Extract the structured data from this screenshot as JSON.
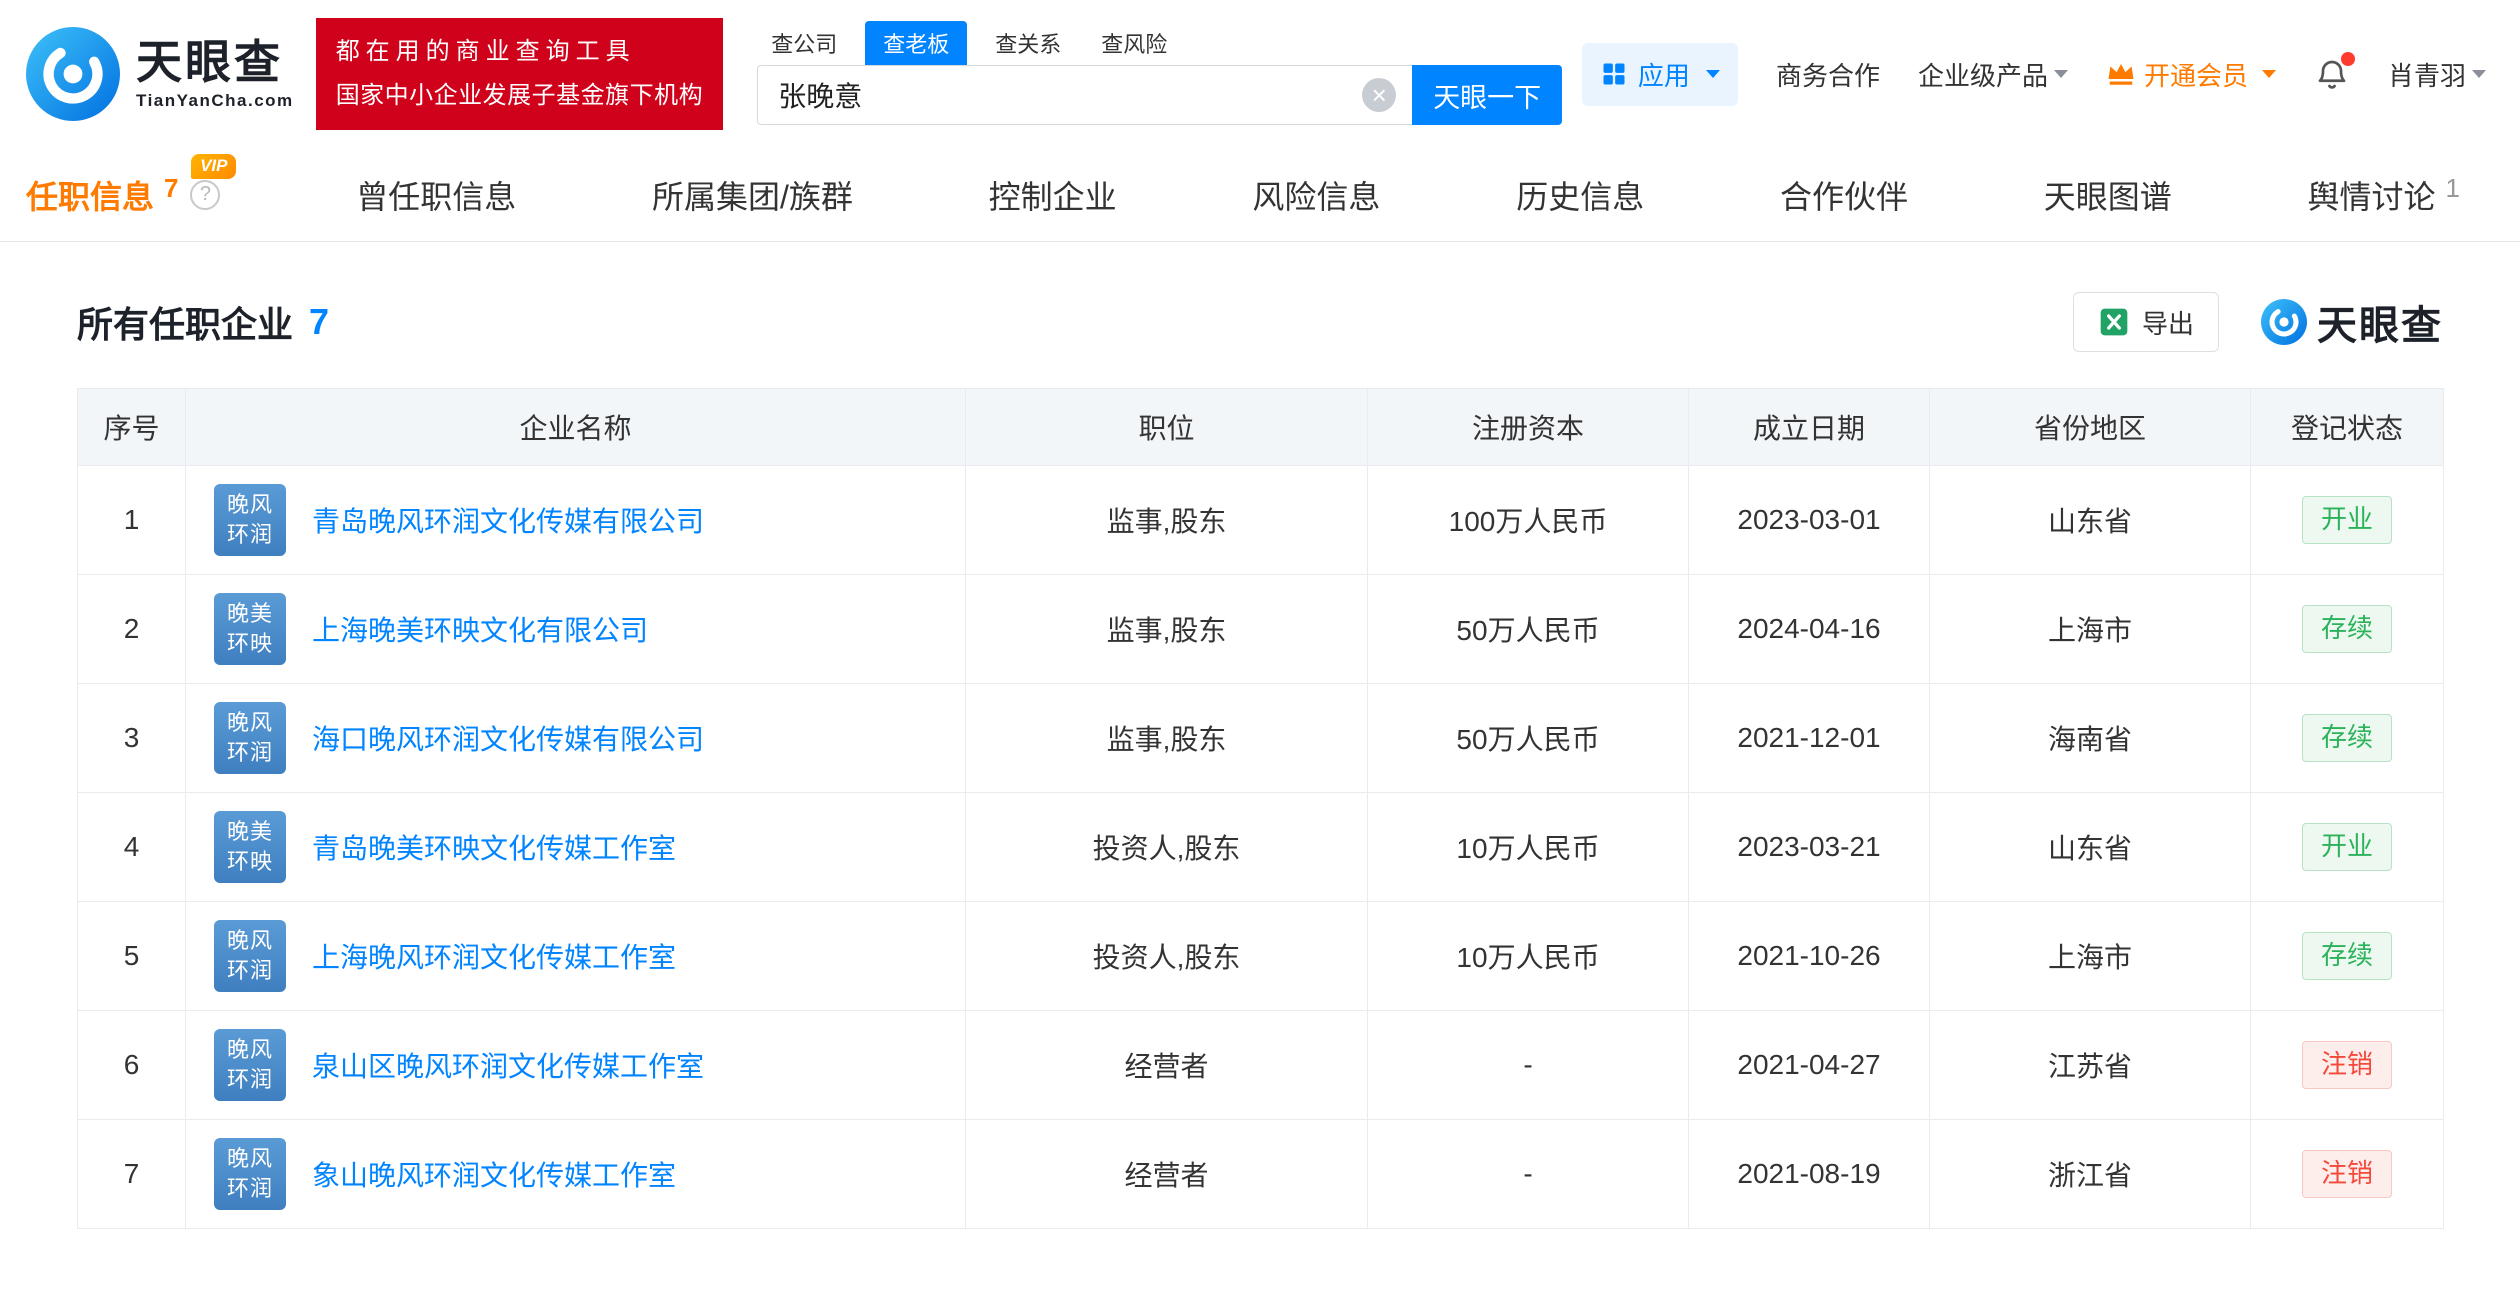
{
  "header": {
    "logo": {
      "brand": "天眼查",
      "domain": "TianYanCha.com"
    },
    "banner": {
      "line1": "都在用的商业查询工具",
      "line2": "国家中小企业发展子基金旗下机构"
    },
    "search": {
      "tabs": [
        {
          "key": "company",
          "label": "查公司",
          "active": false
        },
        {
          "key": "boss",
          "label": "查老板",
          "active": true
        },
        {
          "key": "relation",
          "label": "查关系",
          "active": false
        },
        {
          "key": "risk",
          "label": "查风险",
          "active": false
        }
      ],
      "value": "张晚意",
      "button_label": "天眼一下"
    },
    "nav": {
      "apps_label": "应用",
      "cooperation_label": "商务合作",
      "enterprise_label": "企业级产品",
      "vip_label": "开通会员",
      "username": "肖青羽"
    }
  },
  "tabs": [
    {
      "key": "current-positions",
      "label": "任职信息",
      "count": "7",
      "vip": "VIP",
      "help": true,
      "active": true
    },
    {
      "key": "past-positions",
      "label": "曾任职信息",
      "active": false
    },
    {
      "key": "group",
      "label": "所属集团/族群",
      "active": false
    },
    {
      "key": "controlled-companies",
      "label": "控制企业",
      "active": false
    },
    {
      "key": "risk-info",
      "label": "风险信息",
      "active": false
    },
    {
      "key": "history-info",
      "label": "历史信息",
      "active": false
    },
    {
      "key": "partners",
      "label": "合作伙伴",
      "active": false
    },
    {
      "key": "graph",
      "label": "天眼图谱",
      "active": false
    },
    {
      "key": "public-opinion",
      "label": "舆情讨论",
      "count": "1",
      "active": false
    }
  ],
  "content": {
    "title": "所有任职企业",
    "count": "7",
    "export_label": "导出",
    "brand": "天眼查"
  },
  "table": {
    "columns": [
      "序号",
      "企业名称",
      "职位",
      "注册资本",
      "成立日期",
      "省份地区",
      "登记状态"
    ],
    "rows": [
      {
        "no": "1",
        "logo": [
          "晚风",
          "环润"
        ],
        "name": "青岛晚风环润文化传媒有限公司",
        "position": "监事,股东",
        "capital": "100万人民币",
        "date": "2023-03-01",
        "region": "山东省",
        "status": "开业",
        "status_type": "green"
      },
      {
        "no": "2",
        "logo": [
          "晚美",
          "环映"
        ],
        "name": "上海晚美环映文化有限公司",
        "position": "监事,股东",
        "capital": "50万人民币",
        "date": "2024-04-16",
        "region": "上海市",
        "status": "存续",
        "status_type": "green"
      },
      {
        "no": "3",
        "logo": [
          "晚风",
          "环润"
        ],
        "name": "海口晚风环润文化传媒有限公司",
        "position": "监事,股东",
        "capital": "50万人民币",
        "date": "2021-12-01",
        "region": "海南省",
        "status": "存续",
        "status_type": "green"
      },
      {
        "no": "4",
        "logo": [
          "晚美",
          "环映"
        ],
        "name": "青岛晚美环映文化传媒工作室",
        "position": "投资人,股东",
        "capital": "10万人民币",
        "date": "2023-03-21",
        "region": "山东省",
        "status": "开业",
        "status_type": "green"
      },
      {
        "no": "5",
        "logo": [
          "晚风",
          "环润"
        ],
        "name": "上海晚风环润文化传媒工作室",
        "position": "投资人,股东",
        "capital": "10万人民币",
        "date": "2021-10-26",
        "region": "上海市",
        "status": "存续",
        "status_type": "green"
      },
      {
        "no": "6",
        "logo": [
          "晚风",
          "环润"
        ],
        "name": "泉山区晚风环润文化传媒工作室",
        "position": "经营者",
        "capital": "-",
        "date": "2021-04-27",
        "region": "江苏省",
        "status": "注销",
        "status_type": "red"
      },
      {
        "no": "7",
        "logo": [
          "晚风",
          "环润"
        ],
        "name": "象山晚风环润文化传媒工作室",
        "position": "经营者",
        "capital": "-",
        "date": "2021-08-19",
        "region": "浙江省",
        "status": "注销",
        "status_type": "red"
      }
    ]
  },
  "icons": {
    "clear": "×",
    "help": "?"
  },
  "colors": {
    "brand_blue": "#0084ff",
    "banner_red": "#d0021b",
    "active_orange": "#ff7a00",
    "status_green": "#2bb25a",
    "status_red": "#f5473a",
    "tile_blue": "#4788c7"
  }
}
